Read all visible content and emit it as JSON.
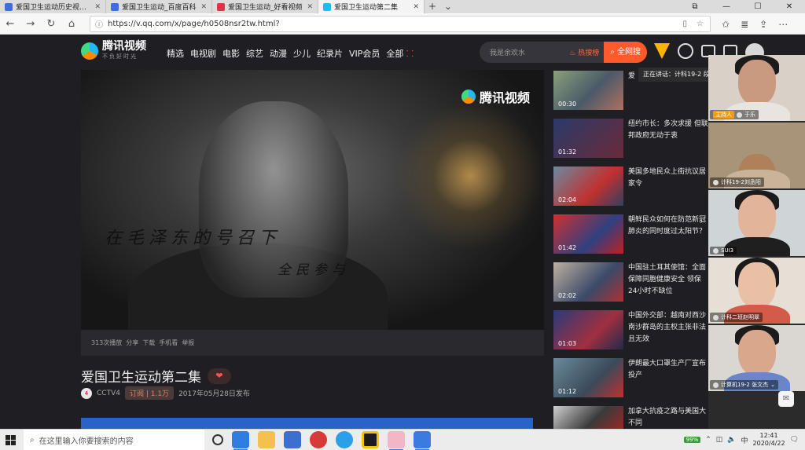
{
  "browser": {
    "tabs": [
      {
        "label": "爱国卫生运动历史视频_百度",
        "color": "#3b6fe0"
      },
      {
        "label": "爱国卫生运动_百度百科",
        "color": "#3b6fe0"
      },
      {
        "label": "爱国卫生运动_好看视频",
        "color": "#e0334a"
      },
      {
        "label": "爱国卫生运动第二集",
        "color": "#22b8f0"
      }
    ],
    "url": "https://v.qq.com/x/page/h0508nsr2tw.html?"
  },
  "site": {
    "logo": "腾讯视频",
    "slogan": "不负好时光",
    "menu": [
      "精选",
      "电视剧",
      "电影",
      "综艺",
      "动漫",
      "少儿",
      "纪录片",
      "VIP会员",
      "全部"
    ],
    "search_placeholder": "我是余欢水",
    "hot_label": "热搜榜",
    "search_button": "全网搜"
  },
  "video": {
    "watermark": "腾讯视频",
    "caption1": "在毛泽东的号召下",
    "caption2": "全民参与",
    "stats": [
      "313次播放",
      "分享",
      "下载",
      "手机看",
      "举报"
    ],
    "title": "爱国卫生运动第二集",
    "channel": "CCTV4",
    "subscribe": "订阅",
    "subscribers": "1.1万",
    "published": "2017年05月28日发布"
  },
  "related": [
    {
      "duration": "00:30",
      "title": "爱"
    },
    {
      "duration": "01:32",
      "title": "纽约市长：多次求援 但联邦政府无动于衷"
    },
    {
      "duration": "02:04",
      "title": "美国多地民众上街抗议居家令"
    },
    {
      "duration": "01:42",
      "title": "朝鲜民众如何在防范新冠肺炎的同时度过太阳节？"
    },
    {
      "duration": "02:02",
      "title": "中国驻土耳其使馆：全面保障同胞健康安全 领保24小时不缺位"
    },
    {
      "duration": "01:03",
      "title": "中国外交部：越南对西沙南沙群岛的主权主张非法且无效"
    },
    {
      "duration": "01:12",
      "title": "伊朗最大口罩生产厂宣布投产"
    },
    {
      "duration": "",
      "title": "加拿大抗疫之路与美国大不同"
    }
  ],
  "call": {
    "speaking": "正在讲话：计科19-2 段",
    "participants": [
      {
        "name": "于乐",
        "host": "主持人"
      },
      {
        "name": "计科19-2刘丞阳",
        "host": ""
      },
      {
        "name": "SUI3",
        "host": ""
      },
      {
        "name": "计科二班赵明翠",
        "host": ""
      },
      {
        "name": "计算机19-2 张文杰",
        "host": ""
      }
    ]
  },
  "taskbar": {
    "search_placeholder": "在这里输入你要搜索的内容",
    "battery": "99%",
    "ime": "中",
    "time": "12:41",
    "date": "2020/4/22"
  }
}
